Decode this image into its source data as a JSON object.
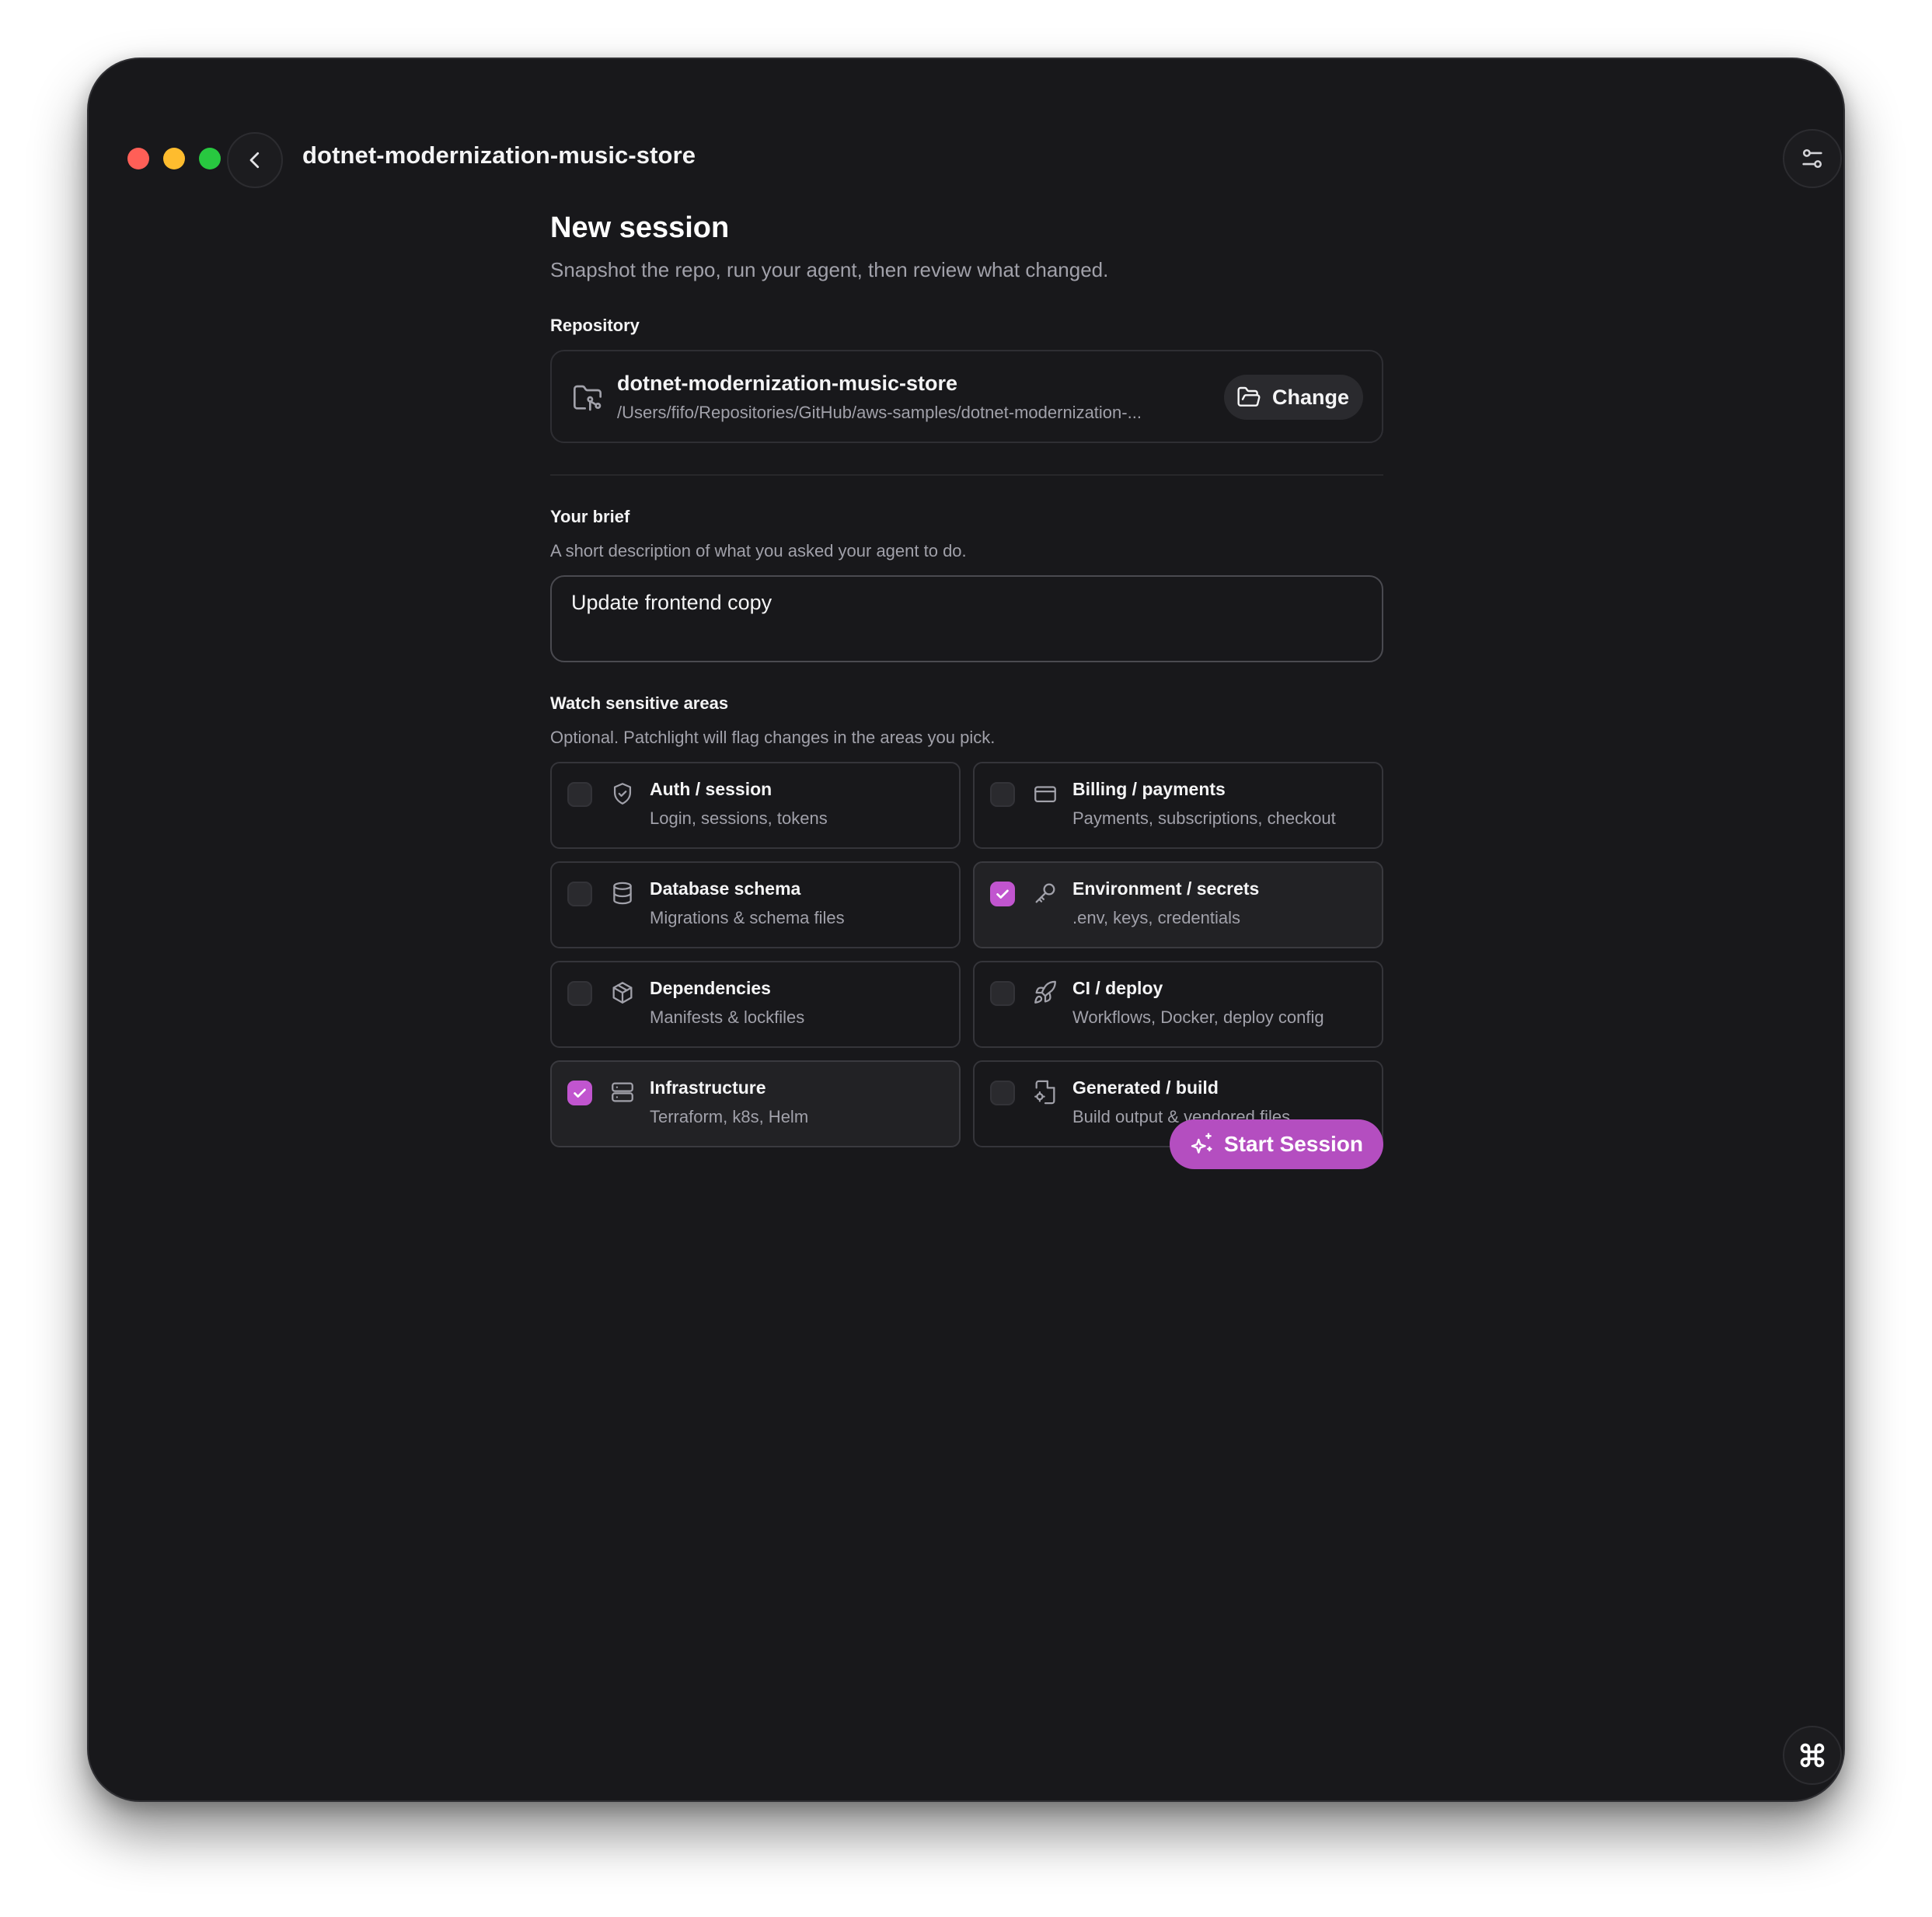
{
  "window": {
    "title": "dotnet-modernization-music-store",
    "traffic_lights": {
      "close": "#ff5f57",
      "minimize": "#febc2e",
      "zoom": "#28c840"
    },
    "back_icon": "chevron-left-icon",
    "settings_icon": "sliders-icon",
    "corner_icon": "command-icon"
  },
  "page": {
    "title": "New session",
    "subtitle": "Snapshot the repo, run your agent, then review what changed."
  },
  "repository": {
    "label": "Repository",
    "name": "dotnet-modernization-music-store",
    "path": "/Users/fifo/Repositories/GitHub/aws-samples/dotnet-modernization-...",
    "icon": "folder-git-icon",
    "change_label": "Change",
    "change_icon": "folder-open-icon"
  },
  "brief": {
    "label": "Your brief",
    "help": "A short description of what you asked your agent to do.",
    "value": "Update frontend copy"
  },
  "sensitive": {
    "label": "Watch sensitive areas",
    "help": "Optional. Patchlight will flag changes in the areas you pick.",
    "areas": [
      {
        "title": "Auth / session",
        "desc": "Login, sessions, tokens",
        "icon": "shield-check-icon",
        "checked": false
      },
      {
        "title": "Billing / payments",
        "desc": "Payments, subscriptions, checkout",
        "icon": "credit-card-icon",
        "checked": false
      },
      {
        "title": "Database schema",
        "desc": "Migrations & schema files",
        "icon": "database-icon",
        "checked": false
      },
      {
        "title": "Environment / secrets",
        "desc": ".env, keys, credentials",
        "icon": "key-icon",
        "checked": true
      },
      {
        "title": "Dependencies",
        "desc": "Manifests & lockfiles",
        "icon": "package-icon",
        "checked": false
      },
      {
        "title": "CI / deploy",
        "desc": "Workflows, Docker, deploy config",
        "icon": "rocket-icon",
        "checked": false
      },
      {
        "title": "Infrastructure",
        "desc": "Terraform, k8s, Helm",
        "icon": "server-icon",
        "checked": true
      },
      {
        "title": "Generated / build",
        "desc": "Build output & vendored files",
        "icon": "file-cog-icon",
        "checked": false
      }
    ]
  },
  "actions": {
    "start_label": "Start Session",
    "start_icon": "sparkles-icon",
    "accent": "#b44ec0"
  }
}
